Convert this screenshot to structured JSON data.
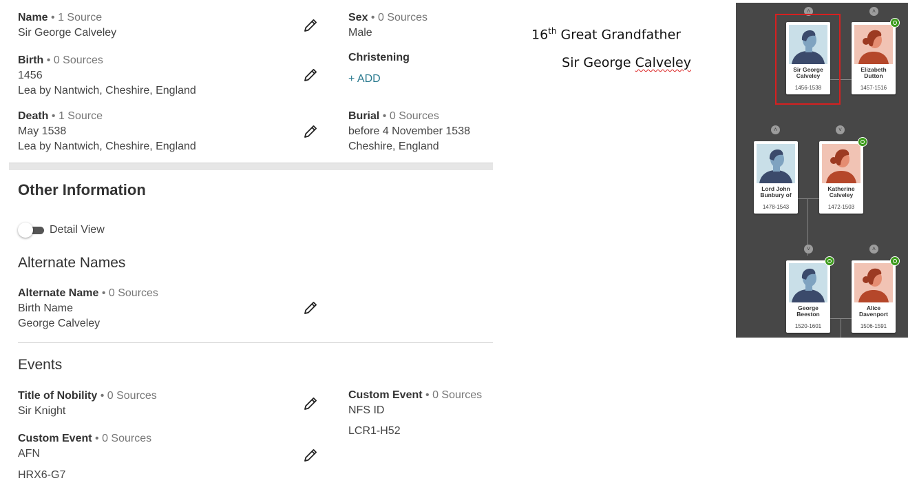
{
  "vitals": {
    "name": {
      "label": "Name",
      "sources": "• 1 Source",
      "value": "Sir George Calveley"
    },
    "sex": {
      "label": "Sex",
      "sources": "• 0 Sources",
      "value": "Male"
    },
    "birth": {
      "label": "Birth",
      "sources": "• 0 Sources",
      "date": "1456",
      "place": "Lea by Nantwich, Cheshire, England"
    },
    "christening": {
      "label": "Christening",
      "add": "+  ADD"
    },
    "death": {
      "label": "Death",
      "sources": "• 1 Source",
      "date": "May 1538",
      "place": "Lea by Nantwich, Cheshire, England"
    },
    "burial": {
      "label": "Burial",
      "sources": "• 0 Sources",
      "date": "before 4 November 1538",
      "place": "Cheshire, England"
    }
  },
  "other": {
    "title": "Other Information",
    "detail_view": "Detail View",
    "alternate_names_title": "Alternate Names",
    "alternate_name": {
      "label": "Alternate Name",
      "sources": "• 0 Sources",
      "type": "Birth Name",
      "value": "George Calveley"
    },
    "events_title": "Events",
    "events": {
      "nobility": {
        "label": "Title of Nobility",
        "sources": "• 0 Sources",
        "value": "Sir Knight"
      },
      "custom_afn": {
        "label": "Custom Event",
        "sources": "• 0 Sources",
        "type": "AFN",
        "value": "HRX6-G7"
      },
      "custom_nfs": {
        "label": "Custom Event",
        "sources": "• 0 Sources",
        "type": "NFS ID",
        "value": "LCR1-H52"
      }
    }
  },
  "annotation": {
    "ordinal": "16",
    "suffix": "th",
    "relation": "Great Grandfather",
    "name_prefix": "Sir George ",
    "name_surname": "Calveley"
  },
  "tree": {
    "colors": {
      "background": "#474747",
      "selection": "#d62020",
      "hint": "#3c9a1b",
      "male_bg": "#c9dfe8",
      "female_bg": "#f1c3b4"
    },
    "people": [
      {
        "name1": "Sir George",
        "name2": "Calveley",
        "dates": "1456-1538"
      },
      {
        "name1": "Elizabeth",
        "name2": "Dutton",
        "dates": "1457-1516"
      },
      {
        "name1": "Lord John",
        "name2": "Bunbury of",
        "dates": "1478-1543"
      },
      {
        "name1": "Katherine",
        "name2": "Calveley",
        "dates": "1472-1503"
      },
      {
        "name1": "George",
        "name2": "Beeston",
        "dates": "1520-1601"
      },
      {
        "name1": "Alice",
        "name2": "Davenport",
        "dates": "1506-1591"
      }
    ]
  }
}
